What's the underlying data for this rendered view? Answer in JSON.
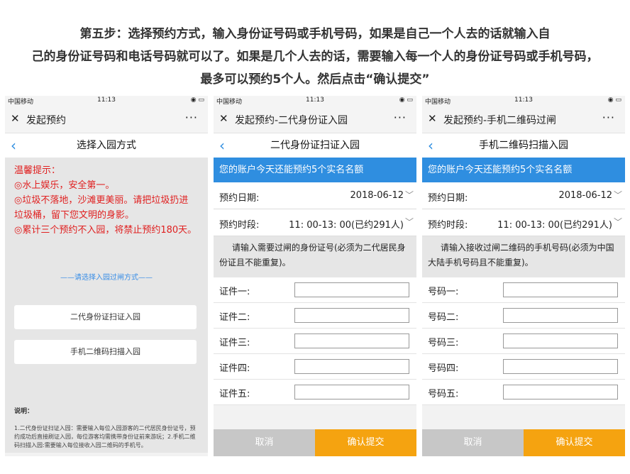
{
  "heading": {
    "line1": "第五步：选择预约方式，输入身份证号码或手机号码，如果是自己一个人去的话就输入自",
    "line2": "己的身份证号码和电话号码就可以了。如果是几个人去的话，需要输入每一个人的身份证号码或手机号码，",
    "line3": "最多可以预约5个人。然后点击“确认提交”"
  },
  "status": {
    "carrier": "中国移动",
    "time": "11:13"
  },
  "screen1": {
    "wx_title": "发起预约",
    "nav_title": "选择入园方式",
    "warn_lines": [
      "温馨提示：",
      "◎水上娱乐，安全第一。",
      "◎垃圾不落地，沙滩更美丽。请把垃圾扔进垃圾桶，留下您文明的身影。",
      "◎累计三个预约不入园，将禁止预约180天。"
    ],
    "select_label": "——请选择入园过闸方式——",
    "btn_id": "二代身份证扫证入园",
    "btn_qr": "手机二维码扫描入园",
    "note_title": "说明：",
    "note_text": "1.二代身份证扫证入园：需要输入每位入园游客的二代居民身份证号，预约成功后直接刷证入园，每位游客均需携带身份证前来游玩；2.手机二维码扫描入园:需要输入每位接收入园二维码的手机号。"
  },
  "screen2": {
    "wx_title": "发起预约-二代身份证入园",
    "nav_title": "二代身份证扫证入园",
    "banner": "您的账户今天还能预约5个实名名额",
    "date_label": "预约日期:",
    "date_value": "2018-06-12",
    "slot_label": "预约时段:",
    "slot_value": "11: 00-13: 00(已约291人)",
    "instruction": "请输入需要过闸的身份证号(必须为二代居民身份证且不能重复)。",
    "fields": [
      "证件一:",
      "证件二:",
      "证件三:",
      "证件四:",
      "证件五:"
    ],
    "cancel": "取消",
    "submit": "确认提交"
  },
  "screen3": {
    "wx_title": "发起预约-手机二维码过闸",
    "nav_title": "手机二维码扫描入园",
    "banner": "您的账户今天还能预约5个实名名额",
    "date_label": "预约日期:",
    "date_value": "2018-06-12",
    "slot_label": "预约时段:",
    "slot_value": "11: 00-13: 00(已约291人)",
    "instruction": "请输入接收过闸二维码的手机号码(必须为中国大陆手机号码且不能重复)。",
    "fields": [
      "号码一:",
      "号码二:",
      "号码三:",
      "号码四:",
      "号码五:"
    ],
    "cancel": "取消",
    "submit": "确认提交"
  },
  "colors": {
    "accent_blue": "#2f8ee0",
    "submit_orange": "#f5a310",
    "warn_red": "#e02020"
  }
}
